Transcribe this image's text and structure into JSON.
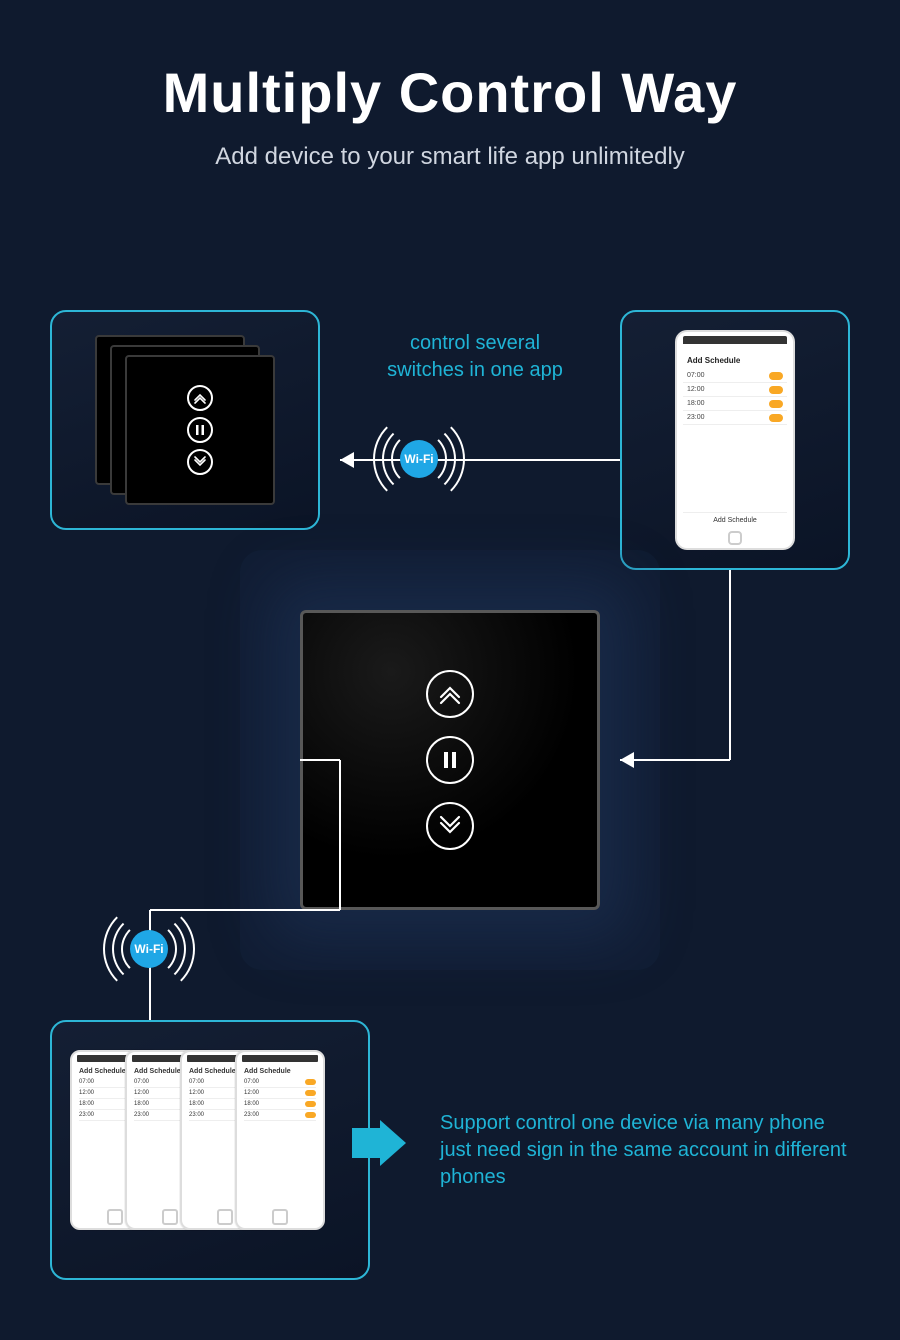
{
  "header": {
    "title": "Multiply Control Way",
    "subtitle": "Add device to your smart life app unlimitedly"
  },
  "captions": {
    "top": "control several switches in one app",
    "bottom": "Support control one device via many phone just need sign in the same account in different phones"
  },
  "wifi_label": "Wi-Fi",
  "phone_app": {
    "title": "Add Schedule",
    "rows": [
      "07:00",
      "12:00",
      "18:00",
      "23:00"
    ],
    "add_button": "Add Schedule"
  }
}
